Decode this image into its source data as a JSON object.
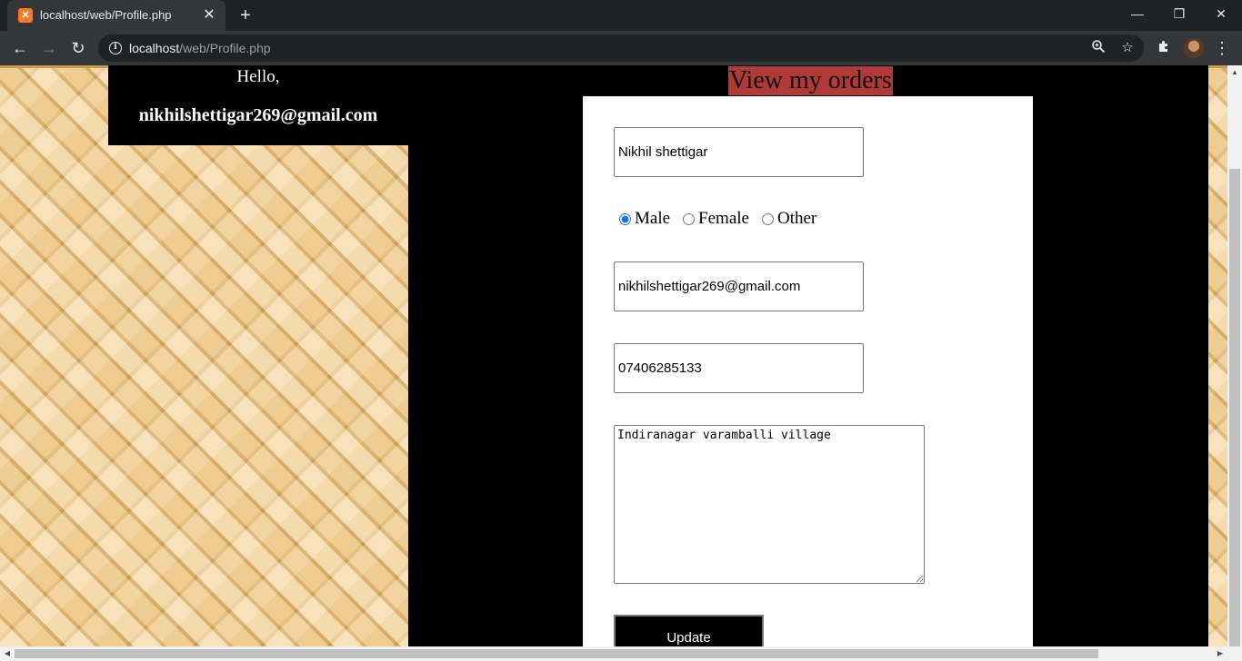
{
  "browser": {
    "tab_title": "localhost/web/Profile.php",
    "favicon_icon": "xampp-icon",
    "close_tab_glyph": "✕",
    "new_tab_glyph": "+",
    "window_controls": {
      "minimize": "—",
      "restore": "❐",
      "close": "✕"
    },
    "nav": {
      "back": "←",
      "forward": "→",
      "reload": "↻"
    },
    "url_host": "localhost",
    "url_path": "/web/Profile.php",
    "omnibox_icons": {
      "zoom": "zoom-icon",
      "bookmark": "☆",
      "extensions": "puzzle-icon",
      "menu": "⋮"
    }
  },
  "greeting": {
    "hello": "Hello,",
    "email": "nikhilshettigar269@gmail.com"
  },
  "orders_link": "View my orders",
  "form": {
    "name": "Nikhil shettigar",
    "gender_options": [
      "Male",
      "Female",
      "Other"
    ],
    "selected_gender": "Male",
    "email": "nikhilshettigar269@gmail.com",
    "phone": "07406285133",
    "address": "Indiranagar varamballi village",
    "update_label": "Update"
  },
  "colors": {
    "orders_link_bg": "#b03a3a",
    "panel_bg": "#000000",
    "card_bg": "#ffffff"
  }
}
